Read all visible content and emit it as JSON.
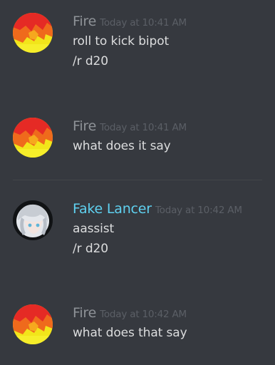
{
  "messages": [
    {
      "author": "Fire",
      "timestamp": "Today at 10:41 AM",
      "lines": [
        "roll to kick bipot",
        "/r d20"
      ]
    },
    {
      "author": "Fire",
      "timestamp": "Today at 10:41 AM",
      "lines": [
        "what does it say"
      ]
    },
    {
      "author": "Fake Lancer",
      "timestamp": "Today at 10:42 AM",
      "lines": [
        "aassist",
        "/r d20"
      ]
    },
    {
      "author": "Fire",
      "timestamp": "Today at 10:42 AM",
      "lines": [
        "what does that say"
      ]
    }
  ],
  "colors": {
    "background": "#36393f",
    "default_username": "#8e9297",
    "lancer_username": "#5fd1f0",
    "message_text": "#dcddde",
    "timestamp": "#5b5f66"
  },
  "icons": {
    "fire_avatar": "fire-avatar-icon",
    "lancer_avatar": "anime-character-avatar-icon"
  }
}
